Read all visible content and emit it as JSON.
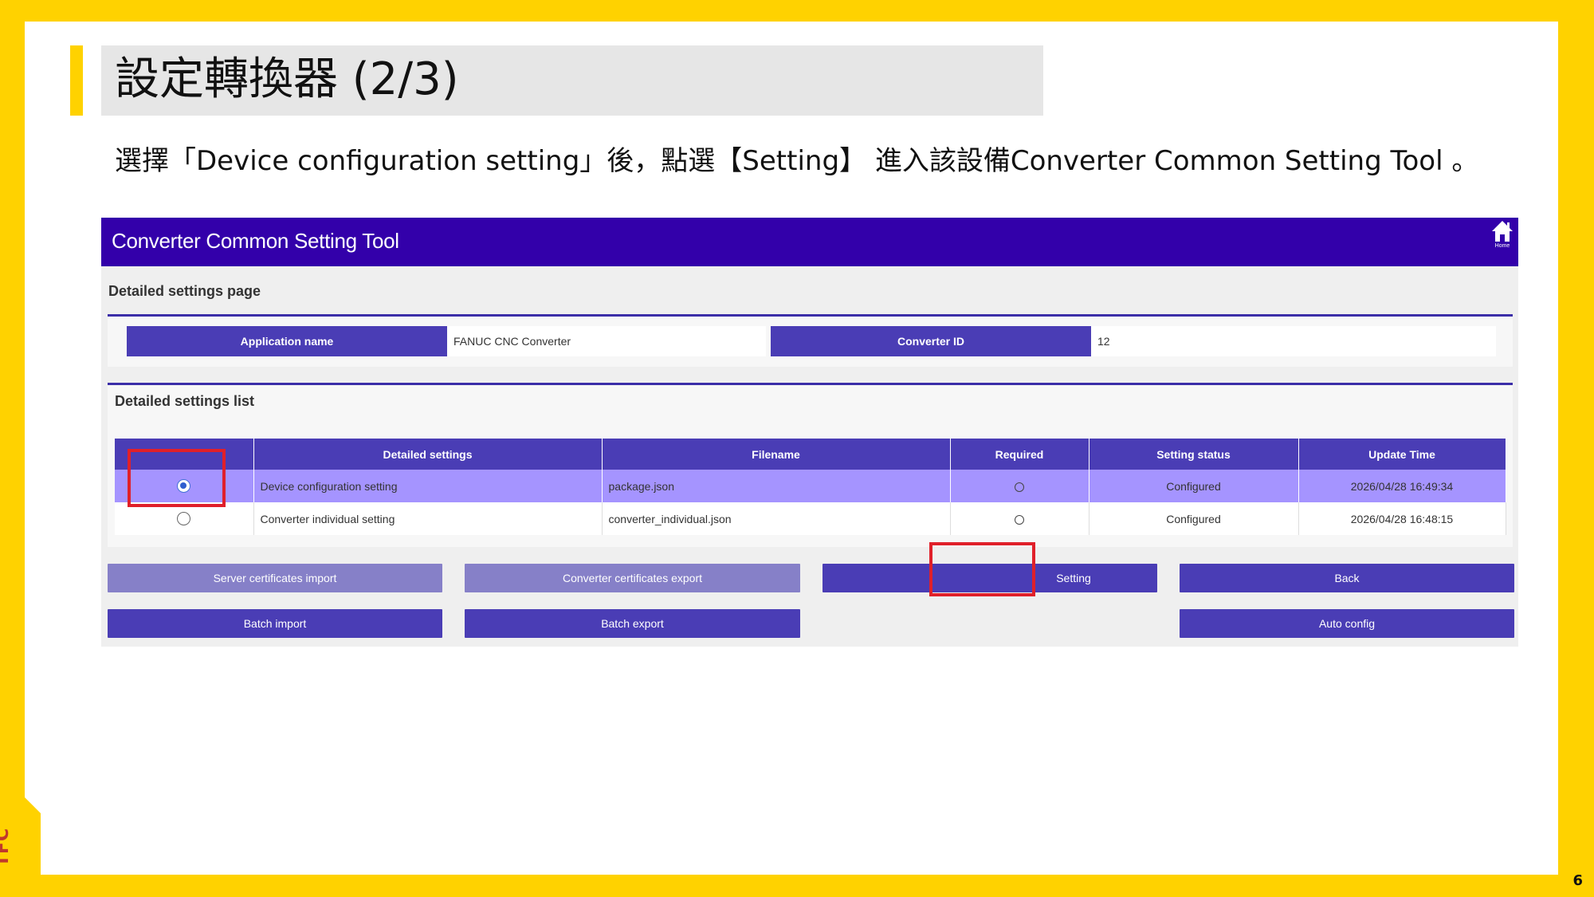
{
  "slide": {
    "title": "設定轉換器 (2/3)",
    "description": "選擇「Device configuration setting」後，點選【Setting】 進入該設備Converter Common Setting Tool 。",
    "logo": "TFC",
    "page_number": "6"
  },
  "app": {
    "title": "Converter Common Setting Tool",
    "home_label": "Home",
    "page_label": "Detailed settings page",
    "info": {
      "app_name_label": "Application name",
      "app_name_value": "FANUC CNC Converter",
      "converter_id_label": "Converter ID",
      "converter_id_value": "12"
    },
    "list_label": "Detailed settings list",
    "columns": [
      "",
      "Detailed settings",
      "Filename",
      "Required",
      "Setting status",
      "Update Time"
    ],
    "rows": [
      {
        "selected": true,
        "setting": "Device configuration setting",
        "filename": "package.json",
        "required": "○",
        "status": "Configured",
        "updated": "2026/04/28 16:49:34"
      },
      {
        "selected": false,
        "setting": "Converter individual setting",
        "filename": "converter_individual.json",
        "required": "○",
        "status": "Configured",
        "updated": "2026/04/28 16:48:15"
      }
    ],
    "buttons": {
      "server_cert_import": "Server certificates import",
      "converter_cert_export": "Converter certificates export",
      "setting": "Setting",
      "back": "Back",
      "batch_import": "Batch import",
      "batch_export": "Batch export",
      "auto_config": "Auto config"
    }
  },
  "colors": {
    "accent_yellow": "#FFD200",
    "header_purple": "#3300AA",
    "button_purple": "#4A3DB5",
    "button_disabled": "#8680C8",
    "selected_row": "#A594FF",
    "highlight_red": "#E0202A"
  }
}
